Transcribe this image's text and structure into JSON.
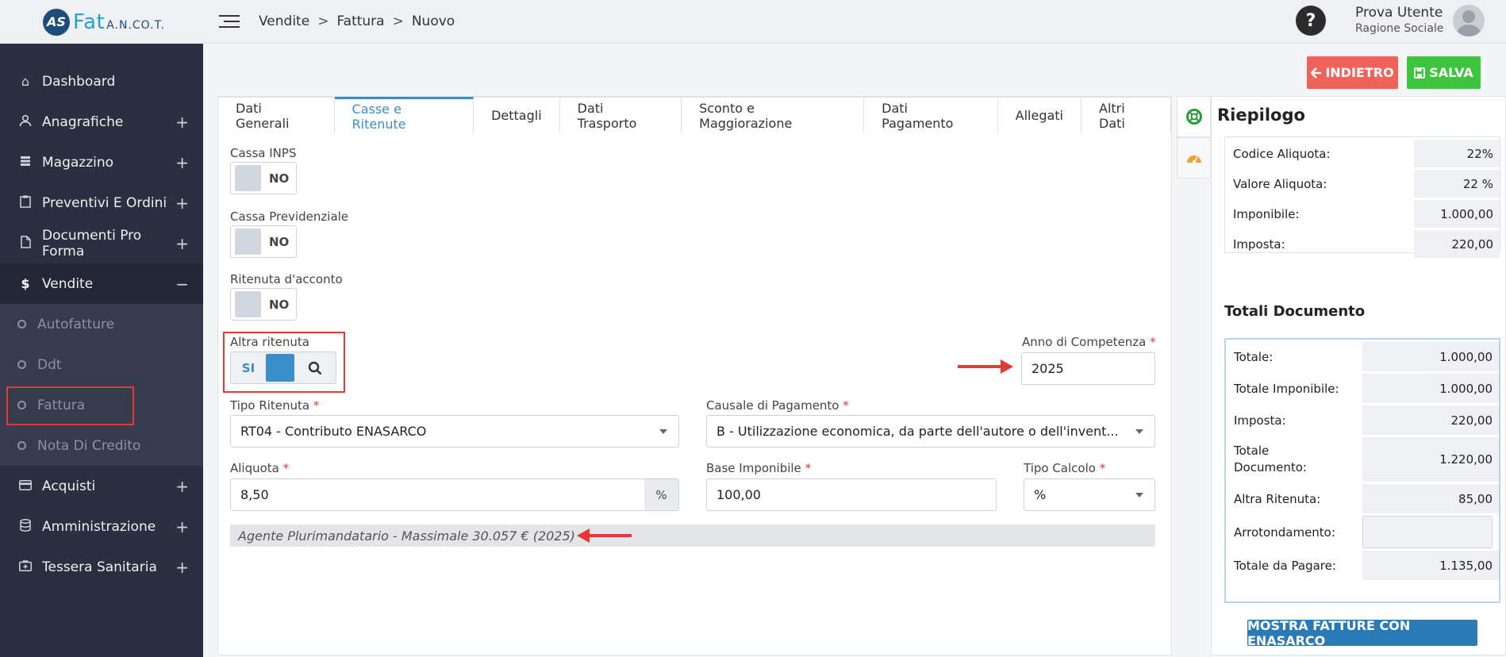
{
  "logo": {
    "mark": "AS",
    "brand": "Fat",
    "suffix": "A.N.CO.T."
  },
  "sidebar": {
    "items": [
      {
        "label": "Dashboard",
        "icon": "home-icon",
        "expand": ""
      },
      {
        "label": "Anagrafiche",
        "icon": "user-icon",
        "expand": "+"
      },
      {
        "label": "Magazzino",
        "icon": "warehouse-icon",
        "expand": "+"
      },
      {
        "label": "Preventivi E Ordini",
        "icon": "clipboard-icon",
        "expand": "+"
      },
      {
        "label": "Documenti Pro Forma",
        "icon": "document-icon",
        "expand": "+"
      },
      {
        "label": "Vendite",
        "icon": "dollar-icon",
        "expand": "−"
      }
    ],
    "subitems": [
      {
        "label": "Autofatture"
      },
      {
        "label": "Ddt"
      },
      {
        "label": "Fattura"
      },
      {
        "label": "Nota Di Credito"
      }
    ],
    "bottom": [
      {
        "label": "Acquisti",
        "expand": "+"
      },
      {
        "label": "Amministrazione",
        "expand": "+"
      },
      {
        "label": "Tessera Sanitaria",
        "expand": "+"
      }
    ]
  },
  "topbar": {
    "breadcrumb": [
      "Vendite",
      "Fattura",
      "Nuovo"
    ],
    "help": "?",
    "user_name": "Prova Utente",
    "user_company": "Ragione Sociale"
  },
  "actions": {
    "back": "INDIETRO",
    "save": "SALVA"
  },
  "tabs": [
    "Dati Generali",
    "Casse e Ritenute",
    "Dettagli",
    "Dati Trasporto",
    "Sconto e Maggiorazione",
    "Dati Pagamento",
    "Allegati",
    "Altri Dati"
  ],
  "active_tab": "Casse e Ritenute",
  "form": {
    "cassa_inps": {
      "label": "Cassa INPS",
      "value": "NO"
    },
    "cassa_prev": {
      "label": "Cassa Previdenziale",
      "value": "NO"
    },
    "ritenuta": {
      "label": "Ritenuta d'acconto",
      "value": "NO"
    },
    "altra_ritenuta": {
      "label": "Altra ritenuta",
      "value": "SI"
    },
    "anno": {
      "label": "Anno di Competenza",
      "value": "2025"
    },
    "tipo_ritenuta": {
      "label": "Tipo Ritenuta",
      "value": "RT04 - Contributo ENASARCO"
    },
    "causale": {
      "label": "Causale di Pagamento",
      "value": "B - Utilizzazione economica, da parte dell'autore o dell'invent..."
    },
    "aliquota": {
      "label": "Aliquota",
      "value": "8,50",
      "unit": "%"
    },
    "base": {
      "label": "Base Imponibile",
      "value": "100,00"
    },
    "tipo_calcolo": {
      "label": "Tipo Calcolo",
      "value": "%"
    },
    "note": "Agente Plurimandatario - Massimale 30.057 € (2025)",
    "required_mark": "*"
  },
  "riepilogo": {
    "title": "Riepilogo",
    "rows": [
      {
        "k": "Codice Aliquota:",
        "v": "22%"
      },
      {
        "k": "Valore Aliquota:",
        "v": "22 %"
      },
      {
        "k": "Imponibile:",
        "v": "1.000,00"
      },
      {
        "k": "Imposta:",
        "v": "220,00"
      }
    ]
  },
  "totali": {
    "title": "Totali Documento",
    "rows": [
      {
        "k": "Totale:",
        "v": "1.000,00"
      },
      {
        "k": "Totale Imponibile:",
        "v": "1.000,00"
      },
      {
        "k": "Imposta:",
        "v": "220,00"
      },
      {
        "k": "Totale Documento:",
        "v": "1.220,00"
      },
      {
        "k": "Altra Ritenuta:",
        "v": "85,00"
      },
      {
        "k": "Arrotondamento:",
        "v": ""
      },
      {
        "k": "Totale da Pagare:",
        "v": "1.135,00"
      }
    ],
    "button": "MOSTRA FATTURE CON ENASARCO"
  },
  "colors": {
    "accent": "#3a8fc9",
    "danger": "#f0635a",
    "success": "#3fc43f",
    "sidebar": "#2b3040"
  }
}
